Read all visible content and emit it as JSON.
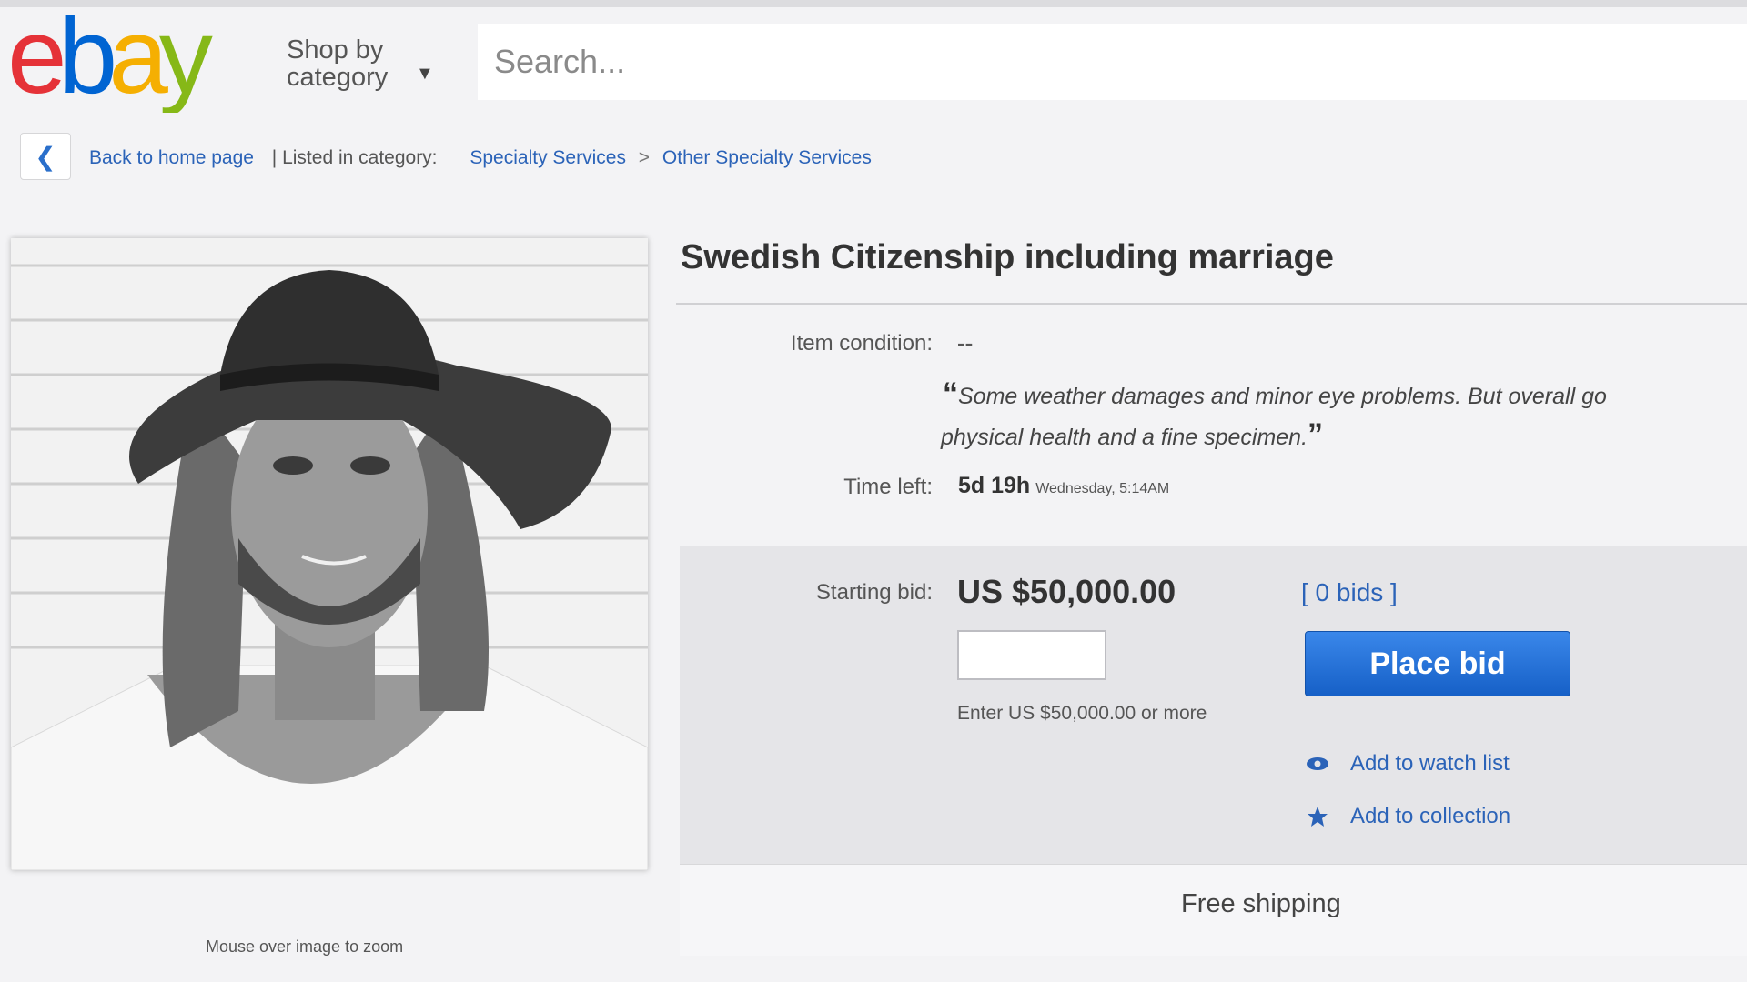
{
  "brand": {
    "logo_text": "ebay",
    "colors": {
      "e": "#e53238",
      "b": "#0064d2",
      "a": "#f5af02",
      "y": "#86b817"
    }
  },
  "header": {
    "shop_by_line1": "Shop by",
    "shop_by_line2": "category",
    "search_placeholder": "Search..."
  },
  "breadcrumb": {
    "back": "Back to home page",
    "listed_in": "| Listed in category:",
    "cat1": "Specialty Services",
    "sep": ">",
    "cat2": "Other Specialty Services"
  },
  "gallery": {
    "zoom_hint": "Mouse over image to zoom"
  },
  "item": {
    "title": "Swedish Citizenship including marriage",
    "condition_label": "Item condition:",
    "condition_value": "--",
    "description_line1": "Some weather damages and minor eye problems. But overall go",
    "description_line2": "physical health and a fine specimen.",
    "time_label": "Time left:",
    "time_value": "5d 19h",
    "time_detail": "Wednesday, 5:14AM"
  },
  "bid": {
    "starting_label": "Starting bid:",
    "price": "US $50,000.00",
    "bids": "[ 0 bids ]",
    "enter_note": "Enter US $50,000.00 or more",
    "place_bid": "Place bid",
    "watch": "Add to watch list",
    "collection": "Add to collection",
    "button_color": "#1d6fd8",
    "link_color": "#2b63b8"
  },
  "shipping": {
    "text": "Free shipping"
  }
}
